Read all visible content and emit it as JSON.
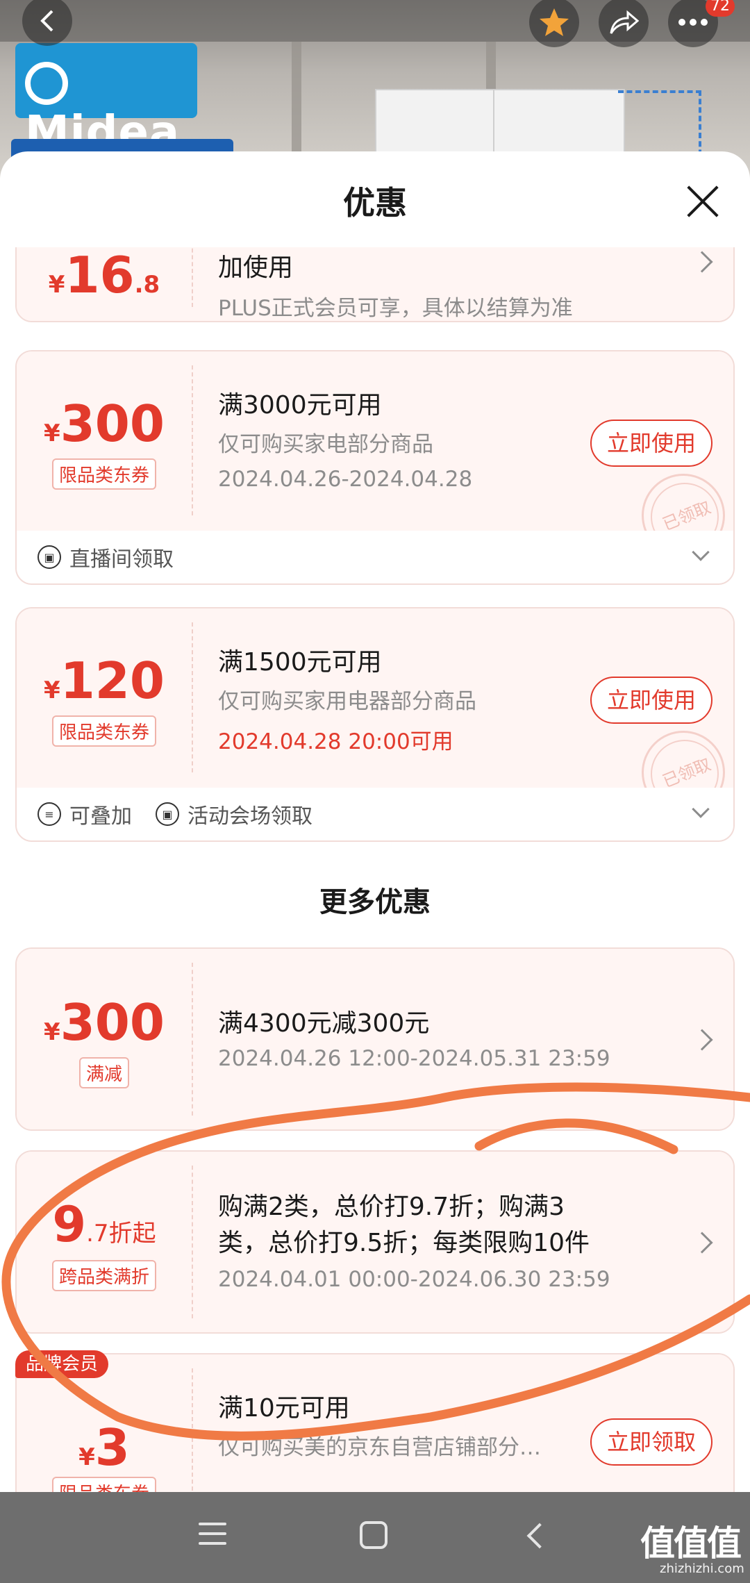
{
  "background_page": {
    "brand_logo_text": "Midea",
    "notification_count": "72"
  },
  "sheet": {
    "title": "优惠"
  },
  "coupons": [
    {
      "amount_symbol": "¥",
      "amount_main": "16",
      "amount_decimal": ".8",
      "line1": "加使用",
      "line2": "PLUS正式会员可享，具体以结算为准"
    },
    {
      "amount_symbol": "¥",
      "amount_main": "300",
      "tag": "限品类东券",
      "line1": "满3000元可用",
      "line2": "仅可购买家电部分商品",
      "line3": "2024.04.26-2024.04.28",
      "button": "立即使用",
      "stamp": "已领取",
      "footer": [
        {
          "icon": "ticket-icon",
          "label": "直播间领取"
        }
      ]
    },
    {
      "amount_symbol": "¥",
      "amount_main": "120",
      "tag": "限品类东券",
      "line1": "满1500元可用",
      "line2": "仅可购买家用电器部分商品",
      "line3": "2024.04.28 20:00可用",
      "button": "立即使用",
      "stamp": "已领取",
      "footer": [
        {
          "icon": "stack-icon",
          "label": "可叠加"
        },
        {
          "icon": "ticket-icon",
          "label": "活动会场领取"
        }
      ]
    }
  ],
  "more_section": {
    "title": "更多优惠",
    "promos": [
      {
        "amount_symbol": "¥",
        "amount_main": "300",
        "tag": "满减",
        "line1": "满4300元减300元",
        "line2": "2024.04.26 12:00-2024.05.31 23:59"
      },
      {
        "amount_main": "9",
        "amount_tail": ".7折起",
        "tag": "跨品类满折",
        "line1": "购满2类，总价打9.7折；购满3",
        "line1b": "类，总价打9.5折；每类限购10件",
        "line2": "2024.04.01 00:00-2024.06.30 23:59"
      },
      {
        "badge": "品牌会员",
        "amount_symbol": "¥",
        "amount_main": "3",
        "tag": "限品类东券",
        "line1": "满10元可用",
        "line2": "仅可购买美的京东自营店铺部分…",
        "button": "立即领取"
      }
    ]
  },
  "watermark": {
    "text": "值值值",
    "url": "zhizhizhi.com"
  },
  "colors": {
    "accent_red": "#e23a2c",
    "ticket_bg": "#fff5f3",
    "scribble": "#f07a45"
  }
}
